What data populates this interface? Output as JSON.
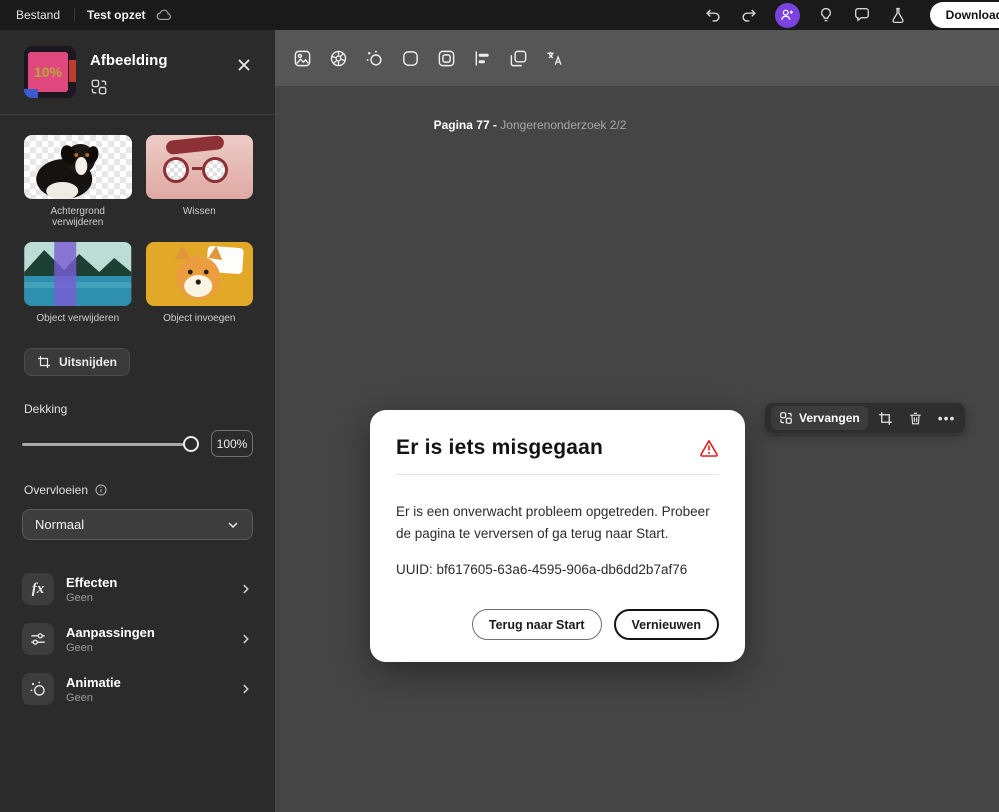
{
  "topbar": {
    "bestand": "Bestand",
    "title": "Test opzet",
    "download": "Download"
  },
  "panel": {
    "title": "Afbeelding",
    "thumb_text": "10%",
    "cards": [
      {
        "label": "Achtergrond verwijderen"
      },
      {
        "label": "Wissen"
      },
      {
        "label": "Object verwijderen"
      },
      {
        "label": "Object invoegen"
      }
    ],
    "crop_button": "Uitsnijden",
    "opacity_label": "Dekking",
    "opacity_value": "100%",
    "blend_label": "Overvloeien",
    "blend_value": "Normaal",
    "rows": [
      {
        "title": "Effecten",
        "subtitle": "Geen"
      },
      {
        "title": "Aanpassingen",
        "subtitle": "Geen"
      },
      {
        "title": "Animatie",
        "subtitle": "Geen"
      }
    ]
  },
  "canvas": {
    "page_label": "Pagina 77 -",
    "page_title": "Jongerenonderzoek 2/2",
    "float_toolbar": {
      "replace_label": "Vervangen",
      "more_label": "•••"
    }
  },
  "modal": {
    "title": "Er is iets misgegaan",
    "body": "Er is een onverwacht probleem opgetreden. Probeer de pagina te verversen of ga terug naar Start.",
    "uuid": "UUID: bf617605-63a6-4595-906a-db6dd2b7af76",
    "back_button": "Terug naar Start",
    "refresh_button": "Vernieuwen"
  },
  "colors": {
    "accent_purple": "#7a42e0",
    "alert_red": "#e11d1d",
    "topbar_bg": "#1a1a1a",
    "sidebar_bg": "#2b2b2b",
    "canvas_bg": "#454545"
  }
}
